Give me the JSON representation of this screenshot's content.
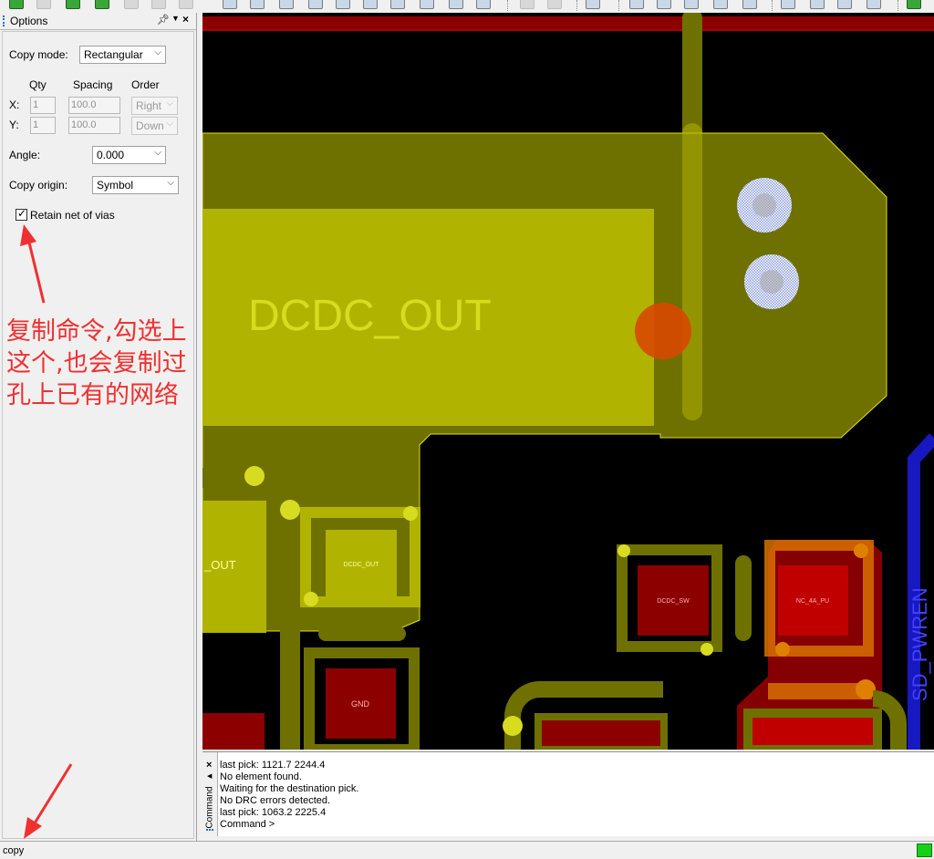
{
  "panel": {
    "title": "Options",
    "pin_icon": "pin-icon",
    "menu_icon": "dropdown-arrow-icon",
    "close_icon": "close-icon"
  },
  "options": {
    "copy_mode_label": "Copy mode:",
    "copy_mode_value": "Rectangular",
    "qty_header": "Qty",
    "spacing_header": "Spacing",
    "order_header": "Order",
    "x_label": "X:",
    "y_label": "Y:",
    "x_qty": "1",
    "y_qty": "1",
    "x_spacing": "100.0",
    "y_spacing": "100.0",
    "x_order": "Right",
    "y_order": "Down",
    "angle_label": "Angle:",
    "angle_value": "0.000",
    "copy_origin_label": "Copy origin:",
    "copy_origin_value": "Symbol",
    "retain_label": "Retain net of vias",
    "retain_checked": true
  },
  "annotation": {
    "text": "复制命令,勾选上这个,也会复制过孔上已有的网络",
    "color": "#f03030"
  },
  "pcb": {
    "net_label": "DCDC_OUT",
    "partial_label": "_OUT",
    "pad_label_1": "DCDC_OUT",
    "pad_label_2": "DCDC_SW",
    "pad_label_3": "NC_4A_PU",
    "gnd_label": "GND",
    "side_net_label": "SD_PWREN",
    "colors": {
      "copper": "#b0b400",
      "copper_dim": "#6e7100",
      "pad_red": "#8c0000",
      "via_blue": "#8c9cdc",
      "trace_blue": "#1818c0"
    }
  },
  "command": {
    "side_label": "Command",
    "lines": [
      "last pick:  1121.7 2244.4",
      "No element found.",
      "Waiting for the destination pick.",
      "No DRC errors detected.",
      "last pick:  1063.2 2225.4",
      "Command >"
    ]
  },
  "status": {
    "text": "copy",
    "indicator_color": "#18d018"
  }
}
